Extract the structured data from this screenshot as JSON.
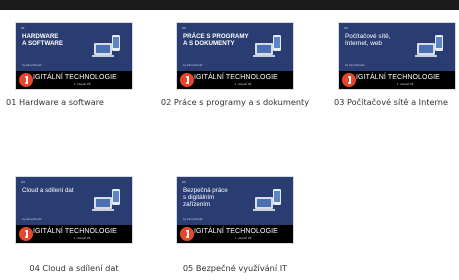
{
  "course": {
    "banner_title": "IGITÁLNÍ TECHNOLOGIE",
    "banner_subtitle": "1. stupeň ZŠ",
    "author": "by Karel Novák",
    "logo_icon": "powerpoint-icon"
  },
  "colors": {
    "slide_bg": "#2a3d73",
    "banner_bg": "#000000",
    "logo": "#e7462c"
  },
  "presentations": [
    {
      "num": "01",
      "slide_title": "HARDWARE\nA SOFTWARE",
      "caption": "01 Hardware a software"
    },
    {
      "num": "02",
      "slide_title": "PRÁCE S PROGRAMY\nA S DOKUMENTY",
      "caption": "02 Práce s programy a s dokumenty"
    },
    {
      "num": "03",
      "slide_title": "Počítačové sítě,\nInternet, web",
      "caption": "03 Počítačové sítě a Interne"
    },
    {
      "num": "04",
      "slide_title": "Cloud a sdílení dat",
      "caption": "04 Cloud a sdílení dat"
    },
    {
      "num": "05",
      "slide_title": "Bezpečná práce\ns digitálním\nzařízením",
      "caption": "05 Bezpečné využívání IT"
    }
  ]
}
